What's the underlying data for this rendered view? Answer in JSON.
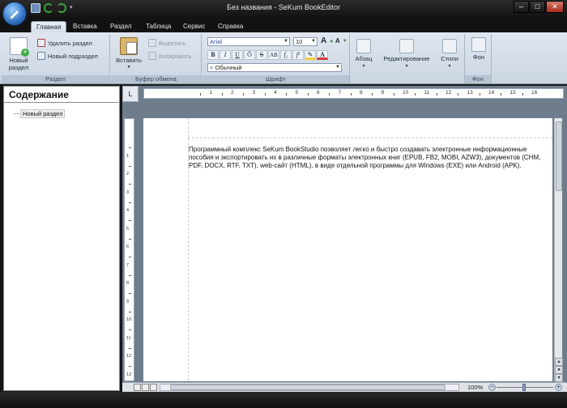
{
  "window": {
    "title": "Без названия - SeKum BookEditor",
    "minimize": "–",
    "maximize": "□",
    "close": "✕"
  },
  "tabs": [
    "Главная",
    "Вставка",
    "Раздел",
    "Таблица",
    "Сервис",
    "Справка"
  ],
  "ribbon": {
    "section_group": {
      "label": "Раздел",
      "new_section": "Новый раздел",
      "delete_section": "Удалить раздел",
      "new_subsection": "Новый подраздел"
    },
    "clipboard_group": {
      "label": "Буфер обмена",
      "paste": "Вставить",
      "cut": "Вырезать",
      "copy": "Копировать"
    },
    "font_group": {
      "label": "Шрифт",
      "font_name": "Arial",
      "font_size": "10",
      "style": "Обычный",
      "bold": "B",
      "italic": "I",
      "underline": "U",
      "strike": "Ö",
      "strike2": "S",
      "caps": "AB",
      "subscript": "f₂",
      "superscript": "f²"
    },
    "paragraph": "Абзац",
    "editing": "Редактирование",
    "styles": "Стили",
    "background": {
      "button": "Фон",
      "label": "Фон"
    }
  },
  "left_panel": {
    "title": "Содержание",
    "items": [
      "Новый раздел"
    ]
  },
  "ruler": {
    "corner": "L",
    "h_numbers": [
      "1",
      "2",
      "3",
      "4",
      "5",
      "6",
      "7",
      "8",
      "9",
      "10",
      "11",
      "12",
      "13",
      "14",
      "15",
      "16"
    ],
    "v_numbers": [
      "1",
      "2",
      "3",
      "4",
      "5",
      "6",
      "7",
      "8",
      "9",
      "10",
      "11",
      "12",
      "13"
    ]
  },
  "document": {
    "text": "Программный комплекс SeKum BookStudio позволяет легко и быстро создавать электронные информационные пособия и экспортировать их в различные форматы электронных книг (EPUB, FB2, MOBI, AZW3), документов (CHM, PDF, DOCX, RTF, TXT), web-сайт (HTML), в виде отдельной программы для Windows (EXE) или Android (APK)."
  },
  "status": {
    "zoom": "100%",
    "zoom_level_percent": 100
  }
}
